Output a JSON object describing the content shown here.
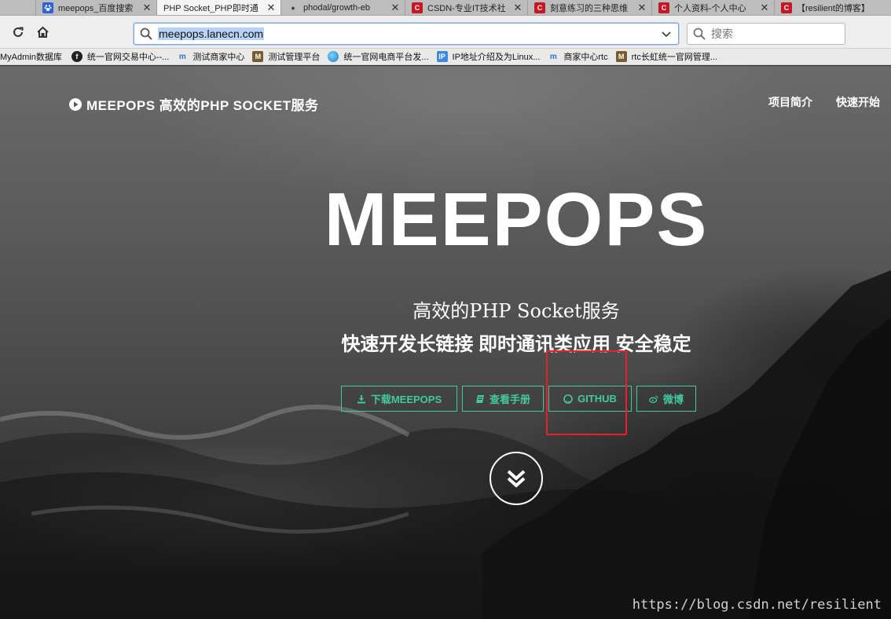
{
  "browser": {
    "tabs": [
      {
        "label": "meepops_百度搜索",
        "favicon": "baidu-paw-icon",
        "active": false
      },
      {
        "label": "PHP Socket_PHP即时通",
        "favicon": "none",
        "active": true
      },
      {
        "label": "phodal/growth-eb",
        "favicon": "dot-icon",
        "active": false
      },
      {
        "label": "CSDN-专业IT技术社",
        "favicon": "csdn-icon",
        "active": false
      },
      {
        "label": "刻意练习的三种思维",
        "favicon": "csdn-icon",
        "active": false
      },
      {
        "label": "个人资料-个人中心",
        "favicon": "csdn-icon",
        "active": false
      },
      {
        "label": "【resilient的博客】",
        "favicon": "csdn-icon",
        "active": false
      }
    ],
    "url": "meepops.lanecn.com",
    "search_placeholder": "搜索",
    "bookmarks": [
      {
        "label": "MyAdmin数据库",
        "icon": "none"
      },
      {
        "label": "统一官网交易中心--...",
        "icon": "dark-circle-icon"
      },
      {
        "label": "测试商家中心",
        "icon": "m-logo-icon"
      },
      {
        "label": "测试管理平台",
        "icon": "avatar-icon"
      },
      {
        "label": "统一官网电商平台发...",
        "icon": "globe-icon"
      },
      {
        "label": "IP地址介绍及为Linux...",
        "icon": "ip-icon"
      },
      {
        "label": "商家中心rtc",
        "icon": "m-logo-icon"
      },
      {
        "label": "rtc长虹统一官网管理...",
        "icon": "avatar-icon"
      }
    ]
  },
  "page": {
    "brand": "MEEPOPS 高效的PHP SOCKET服务",
    "nav": [
      "项目简介",
      "快速开始"
    ],
    "hero_title": "MEEPOPS",
    "hero_subtitle": "高效的PHP Socket服务",
    "hero_tagline": "快速开发长链接 即时通讯类应用 安全稳定",
    "buttons": [
      {
        "label": "下载MEEPOPS",
        "icon": "download-icon"
      },
      {
        "label": "查看手册",
        "icon": "book-icon"
      },
      {
        "label": "GITHUB",
        "icon": "github-icon"
      },
      {
        "label": "微博",
        "icon": "weibo-icon"
      }
    ],
    "accent_color": "#42c9a0",
    "highlight_color": "#e8202a"
  },
  "watermark": "https://blog.csdn.net/resilient"
}
